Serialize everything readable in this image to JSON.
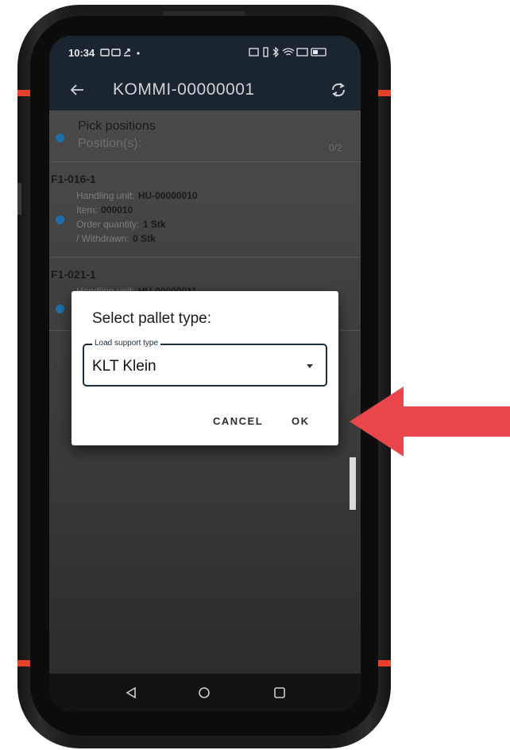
{
  "status_bar": {
    "time": "10:34"
  },
  "app_bar": {
    "back_icon": "arrow-left-icon",
    "title": "KOMMI-00000001",
    "sync_icon": "sync-icon"
  },
  "header_item": {
    "title": "Pick positions",
    "subtitle": "Position(s):",
    "count": "0/2"
  },
  "positions": [
    {
      "location": "F1-016-1",
      "handling_unit_label": "Handling unit:",
      "handling_unit": "HU-00000010",
      "item_label": "Item:",
      "item": "000010",
      "order_qty_label": "Order quantity:",
      "order_qty": "1 Stk",
      "withdrawn_label": "/ Withdrawn:",
      "withdrawn": "0 Stk"
    },
    {
      "location": "F1-021-1",
      "handling_unit_label": "Handling unit:",
      "handling_unit": "HU-00000011"
    }
  ],
  "dialog": {
    "title": "Select pallet type:",
    "field_label": "Load support type",
    "field_value": "KLT Klein",
    "cancel_label": "CANCEL",
    "ok_label": "OK"
  },
  "nav_bar": {
    "back": "triangle-back-icon",
    "home": "circle-home-icon",
    "recents": "square-recents-icon"
  },
  "colors": {
    "accent_red": "#e7412b",
    "app_bar": "#1b2530",
    "dot_blue": "#1e6fa8",
    "arrow_red": "#e8464a"
  }
}
